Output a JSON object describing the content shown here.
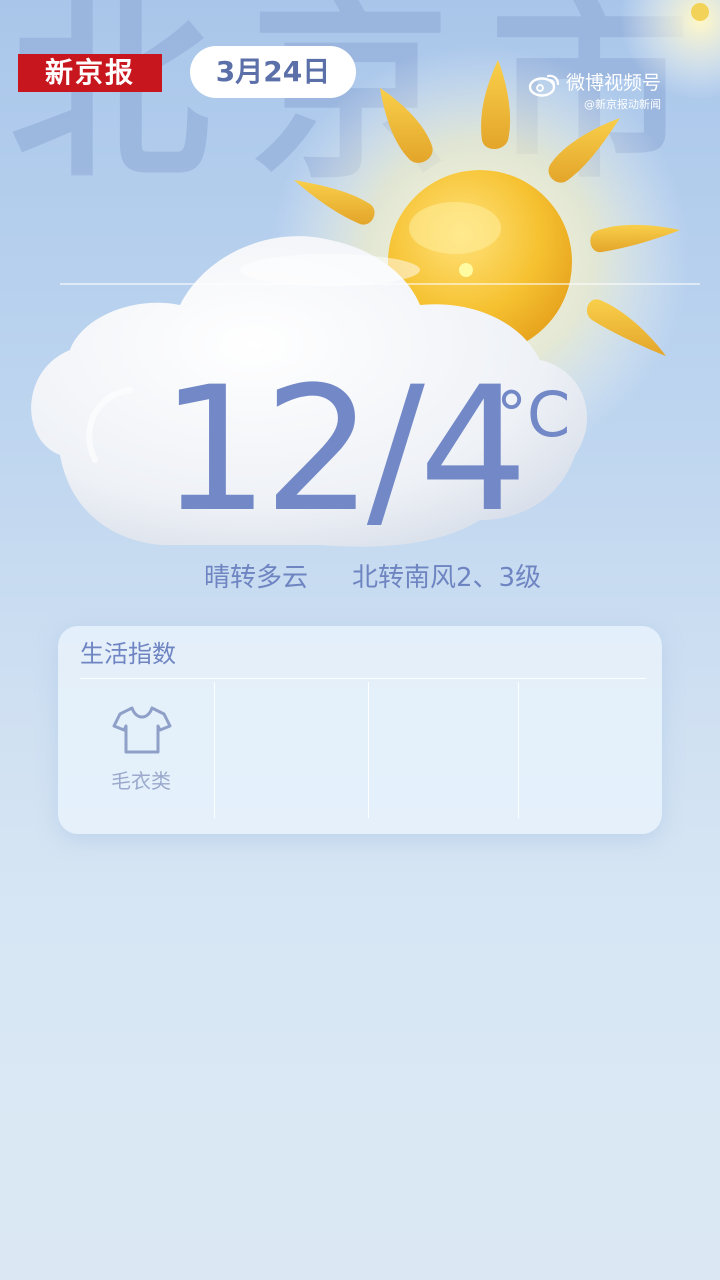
{
  "background": {
    "city_name": "北京市"
  },
  "header": {
    "logo": "新京报",
    "date": "3月24日",
    "watermark": {
      "platform": "微博视频号",
      "account": "@新京报动新闻"
    }
  },
  "weather": {
    "temperature": "12/4",
    "unit": "°C",
    "condition": "晴转多云",
    "wind": "北转南风2、3级",
    "icon": "sun-behind-cloud-icon"
  },
  "life_index": {
    "title": "生活指数",
    "items": [
      {
        "label": "毛衣类",
        "icon": "tshirt-icon"
      }
    ]
  },
  "colors": {
    "accent": "#7288c7",
    "logo_red": "#c8161e",
    "sun": "#f6c232",
    "background_top": "#a9c6ea",
    "background_bottom": "#dbe8f4"
  }
}
